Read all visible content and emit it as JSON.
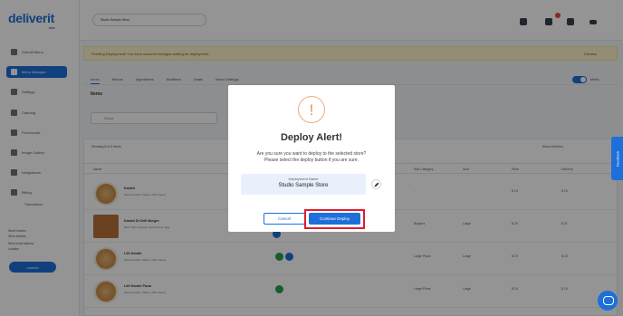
{
  "sidebar": {
    "logo": "deliverit",
    "logo_sub": "DMS",
    "items": [
      {
        "label": "Overall Menu"
      },
      {
        "label": "Menu Manager"
      },
      {
        "label": "Settings"
      },
      {
        "label": "Catering"
      },
      {
        "label": "Promocode"
      },
      {
        "label": "Image Gallery"
      },
      {
        "label": "Integrations"
      },
      {
        "label": "Billing"
      }
    ],
    "sub_item": "Transactions",
    "footer_lines": [
      "Store Number",
      "Store address",
      "Store email address",
      "Location"
    ],
    "launch_button": "Launch"
  },
  "header": {
    "store_select": "Studio Sample Store"
  },
  "banner": {
    "text": "Pending Deployment! You have unsaved changes waiting for deployment",
    "dismiss": "Dismiss"
  },
  "tabs": [
    "Items",
    "Menus",
    "Ingredients",
    "Modifiers",
    "Deals",
    "Menu Settings"
  ],
  "toggle_label": "Metric",
  "items_title": "Items",
  "search_placeholder": "Search",
  "table": {
    "count_text": "Showing 5 of 5 Items",
    "filter_label": "Show All Items",
    "columns": [
      "Name",
      "Sub Category",
      "Size",
      "Price",
      "Delivery"
    ],
    "rows": [
      {
        "name": "Karahi",
        "desc": "Sweet Karahi Chicken, Mint Sauce",
        "sub": "-",
        "size": "",
        "price": "$ 19",
        "delivery": "$ 19"
      },
      {
        "name": "Karahi Di Grill Burger",
        "desc": "Beef Patty, Cheese, Red Onions, Egg",
        "sub": "Burgers",
        "size": "Large",
        "price": "$ 20",
        "delivery": "$ 21"
      },
      {
        "name": "Lilli Karahi",
        "desc": "Sweet Karahi Chicken, Mint Sauce",
        "sub": "Large Pizza",
        "size": "Large",
        "price": "$ 19",
        "delivery": "$ 19"
      },
      {
        "name": "Lilli Karahi Pizza",
        "desc": "Sweet Karahi Chicken, Mint Sauce",
        "sub": "Large Pizza",
        "size": "Large",
        "price": "$ 19",
        "delivery": "$ 19"
      }
    ]
  },
  "feedback": "Feedback",
  "modal": {
    "icon": "!",
    "title": "Deploy Alert!",
    "message_line1": "Are you sure you want to deploy to the selected store?",
    "message_line2": "Please select the deploy button if you are sure.",
    "deployment_label": "Deployment Name",
    "deployment_value": "Studio Sample Store",
    "cancel_label": "Cancel",
    "continue_label": "Continue Deploy"
  },
  "colors": {
    "primary": "#1e6fd9",
    "highlight": "#e11d2a",
    "alert": "#f08a5d"
  }
}
